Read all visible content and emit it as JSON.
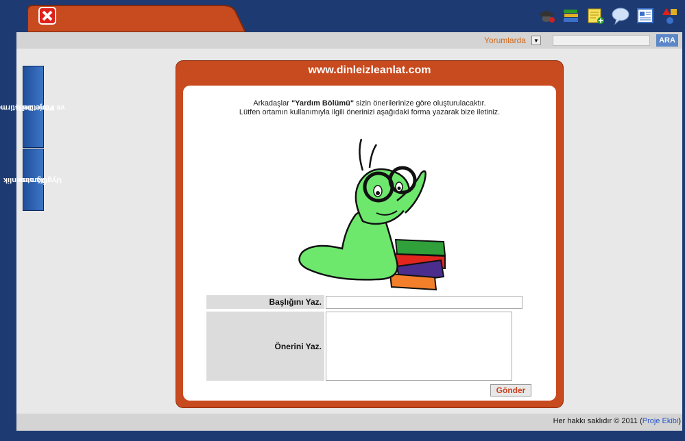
{
  "toolbar": {
    "left_icons": [
      "home-icon",
      "help-icon",
      "profile-icon",
      "print-icon",
      "close-icon"
    ],
    "right_icons": [
      "graduation-icon",
      "books-icon",
      "notes-add-icon",
      "chat-bubble-icon",
      "news-icon",
      "shapes-icon"
    ]
  },
  "search": {
    "scope_label": "Yorumlarda",
    "button_label": "ARA",
    "value": ""
  },
  "sidebar": {
    "items": [
      {
        "label_line1": "Proje Geliştirme",
        "label_line2": "ve Yönetimi II"
      },
      {
        "label_line1": "Öğretmenlik",
        "label_line2": "Uygulaması"
      }
    ]
  },
  "card": {
    "title": "www.dinleizleanlat.com",
    "intro_prefix": "Arkadaşlar ",
    "intro_bold": "\"Yardım Bölümü\"",
    "intro_suffix": " sizin önerilerinize göre oluşturulacaktır.",
    "intro_line2": "Lütfen ortamın kullanımıyla ilgili önerinizi aşağıdaki forma yazarak bize iletiniz.",
    "form": {
      "title_label": "Başlığını Yaz.",
      "title_value": "",
      "suggestion_label": "Önerini Yaz.",
      "suggestion_value": "",
      "submit_label": "Gönder"
    }
  },
  "footer": {
    "copyright": "Her hakkı saklıdır © 2011 (",
    "link": "Proje Ekibi",
    "close": ")"
  },
  "colors": {
    "background": "#1d3a72",
    "card": "#c84a1f",
    "accent_button": "#5b86c7",
    "sidebar_tab": "#2e5fae"
  }
}
